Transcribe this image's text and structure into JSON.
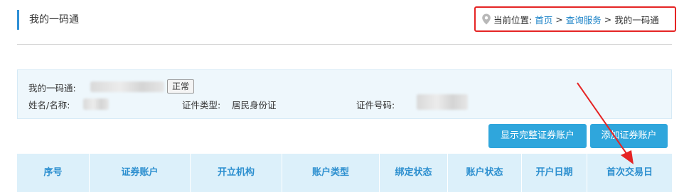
{
  "header": {
    "page_title": "我的一码通"
  },
  "breadcrumb": {
    "prefix": "当前位置:",
    "home": "首页",
    "separator": ">",
    "section": "查询服务",
    "current": "我的一码通",
    "icon": "location-pin-icon"
  },
  "info": {
    "code_label": "我的一码通:",
    "status_tag": "正常",
    "name_label": "姓名/名称:",
    "id_type_label": "证件类型:",
    "id_type_value": "居民身份证",
    "id_number_label": "证件号码:"
  },
  "actions": {
    "show_full": "显示完整证券账户",
    "add_account": "添加证券账户"
  },
  "table": {
    "columns": [
      "序号",
      "证券账户",
      "开立机构",
      "账户类型",
      "绑定状态",
      "账户状态",
      "开户日期",
      "首次交易日"
    ]
  },
  "colors": {
    "accent": "#2fa6dc",
    "link": "#1a82c7",
    "highlight_border": "#e52424",
    "header_bg": "#dcf0fa"
  }
}
